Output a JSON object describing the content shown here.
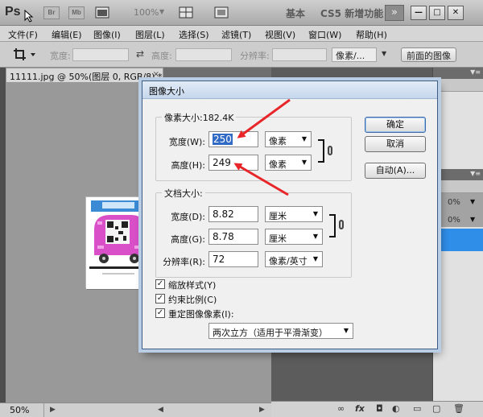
{
  "app": {
    "logo": "Ps",
    "mini_apps": [
      "Br",
      "Mb"
    ],
    "zoom": "100%",
    "workspace_basic": "基本",
    "workspace_new": "CS5 新增功能",
    "more": "»",
    "window_buttons": [
      "—",
      "□",
      "✕"
    ]
  },
  "menu": [
    "文件(F)",
    "编辑(E)",
    "图像(I)",
    "图层(L)",
    "选择(S)",
    "滤镜(T)",
    "视图(V)",
    "窗口(W)",
    "帮助(H)"
  ],
  "options": {
    "width_label": "宽度:",
    "height_label": "高度:",
    "resolution_label": "分辨率:",
    "unit": "像素/...",
    "front_image": "前面的图像"
  },
  "document": {
    "tab_title": "11111.jpg @ 50%(图层 0, RGB/8) *",
    "close": "×",
    "status_zoom": "50%"
  },
  "panels": {
    "tab1": "",
    "tab2": "",
    "pct1": "0%",
    "pct2": "0%"
  },
  "dialog": {
    "title": "图像大小",
    "pixel_dims_label": "像素大小:182.4K",
    "width_label": "宽度(W):",
    "width_value": "250",
    "height_label": "高度(H):",
    "height_value": "249",
    "pixel_unit": "像素",
    "doc_size_label": "文档大小:",
    "doc_width_label": "宽度(D):",
    "doc_width_value": "8.82",
    "doc_height_label": "高度(G):",
    "doc_height_value": "8.78",
    "doc_unit": "厘米",
    "resolution_label": "分辨率(R):",
    "resolution_value": "72",
    "resolution_unit": "像素/英寸",
    "ok": "确定",
    "cancel": "取消",
    "auto": "自动(A)...",
    "scale_styles": "缩放样式(Y)",
    "constrain": "约束比例(C)",
    "resample": "重定图像像素(I):",
    "resample_method": "两次立方（适用于平滑渐变）",
    "check_mark": "✓"
  },
  "colors": {
    "annotation_arrow": "#e8262a",
    "selection": "#316ac5",
    "panel_highlight": "#2f8ee8"
  }
}
